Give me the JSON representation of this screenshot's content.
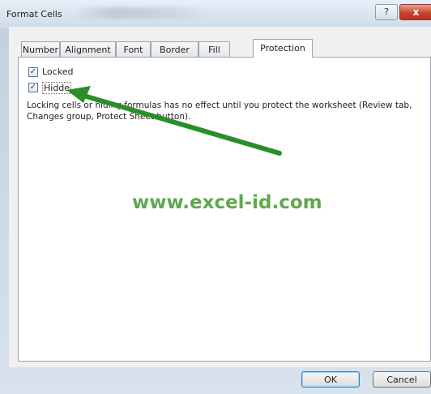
{
  "window": {
    "title": "Format Cells",
    "help_label": "?",
    "close_label": "x"
  },
  "tabs": [
    {
      "label": "Number"
    },
    {
      "label": "Alignment"
    },
    {
      "label": "Font"
    },
    {
      "label": "Border"
    },
    {
      "label": "Fill"
    },
    {
      "label": "Protection",
      "active": true
    }
  ],
  "protection": {
    "locked_label": "Locked",
    "locked_checked": true,
    "hidden_label": "Hidde",
    "hidden_checked": true,
    "note": "Locking cells or hiding formulas has no effect until you protect the worksheet (Review tab, Changes group, Protect Sheet button)."
  },
  "watermark": "www.excel-id.com",
  "buttons": {
    "ok_label": "OK",
    "cancel_label": "Cancel"
  },
  "colors": {
    "arrow": "#2a8f2a",
    "watermark": "#5fa84f"
  }
}
